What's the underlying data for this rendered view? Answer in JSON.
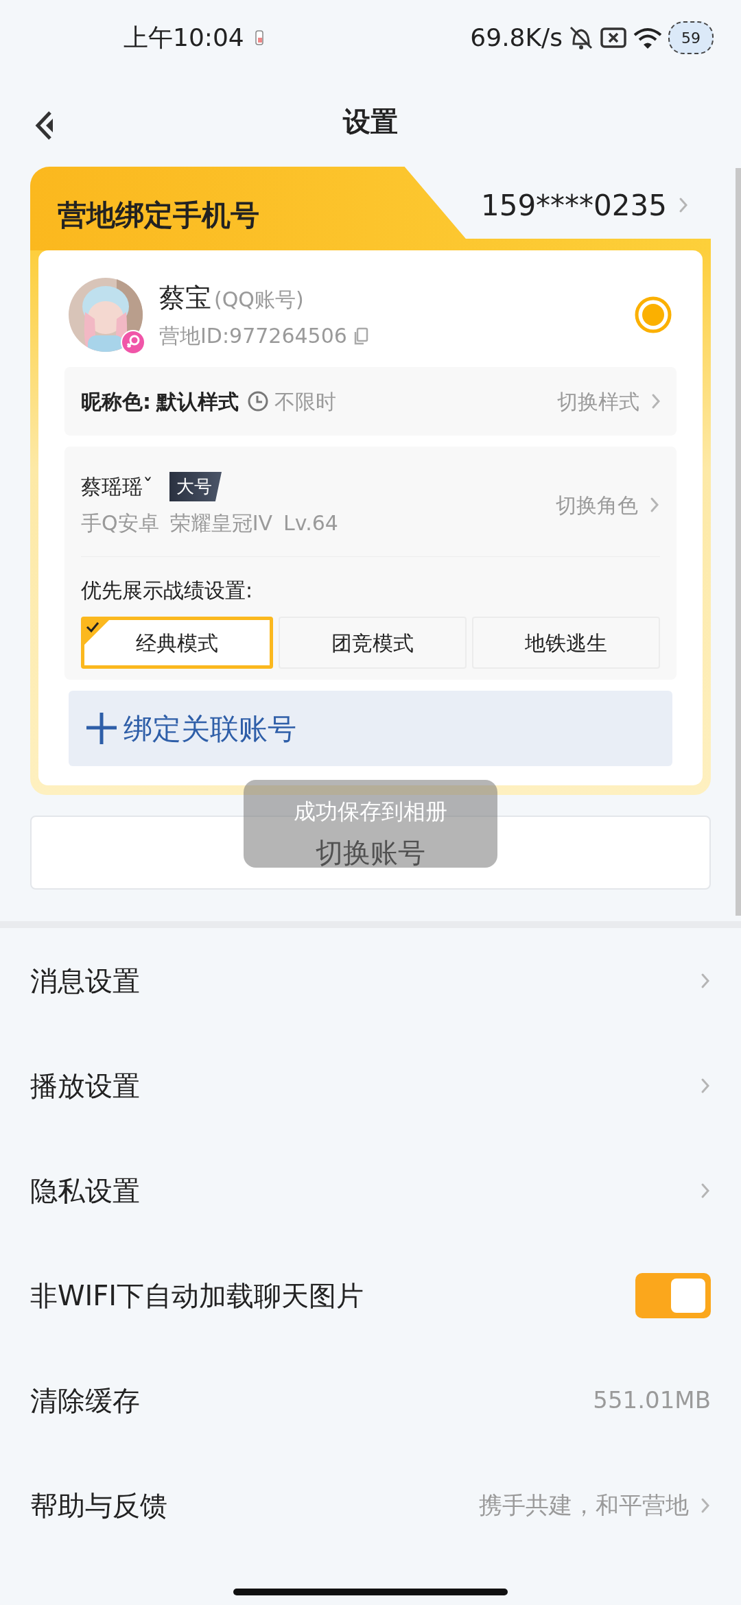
{
  "status_bar": {
    "time": "上午10:04",
    "net_speed": "69.8K/s",
    "battery": "59"
  },
  "header": {
    "title": "设置"
  },
  "account_card": {
    "title": "营地绑定手机号",
    "phone": "159****0235",
    "name": "蔡宝",
    "account_type": "(QQ账号)",
    "camp_id": "营地ID:977264506",
    "selected": true,
    "nickname_color": {
      "label": "昵称色:",
      "value": "默认样式",
      "duration": "不限时",
      "action": "切换样式"
    },
    "role": {
      "name": "蔡瑶瑶ˇ",
      "tag": "大号",
      "info": [
        "手Q安卓",
        "荣耀皇冠IV",
        "Lv.64"
      ],
      "action": "切换角色"
    },
    "modes_label": "优先展示战绩设置:",
    "modes": [
      {
        "label": "经典模式",
        "selected": true
      },
      {
        "label": "团竞模式",
        "selected": false
      },
      {
        "label": "地铁逃生",
        "selected": false
      }
    ],
    "bind": "绑定关联账号"
  },
  "switch_account": "切换账号",
  "toast": "成功保存到相册",
  "settings": [
    {
      "kind": "link",
      "label": "消息设置"
    },
    {
      "kind": "link",
      "label": "播放设置"
    },
    {
      "kind": "link",
      "label": "隐私设置"
    },
    {
      "kind": "toggle",
      "label": "非WIFI下自动加载聊天图片",
      "on": true
    },
    {
      "kind": "value",
      "label": "清除缓存",
      "value": "551.01MB"
    },
    {
      "kind": "link",
      "label": "帮助与反馈",
      "value": "携手共建，和平营地"
    }
  ]
}
